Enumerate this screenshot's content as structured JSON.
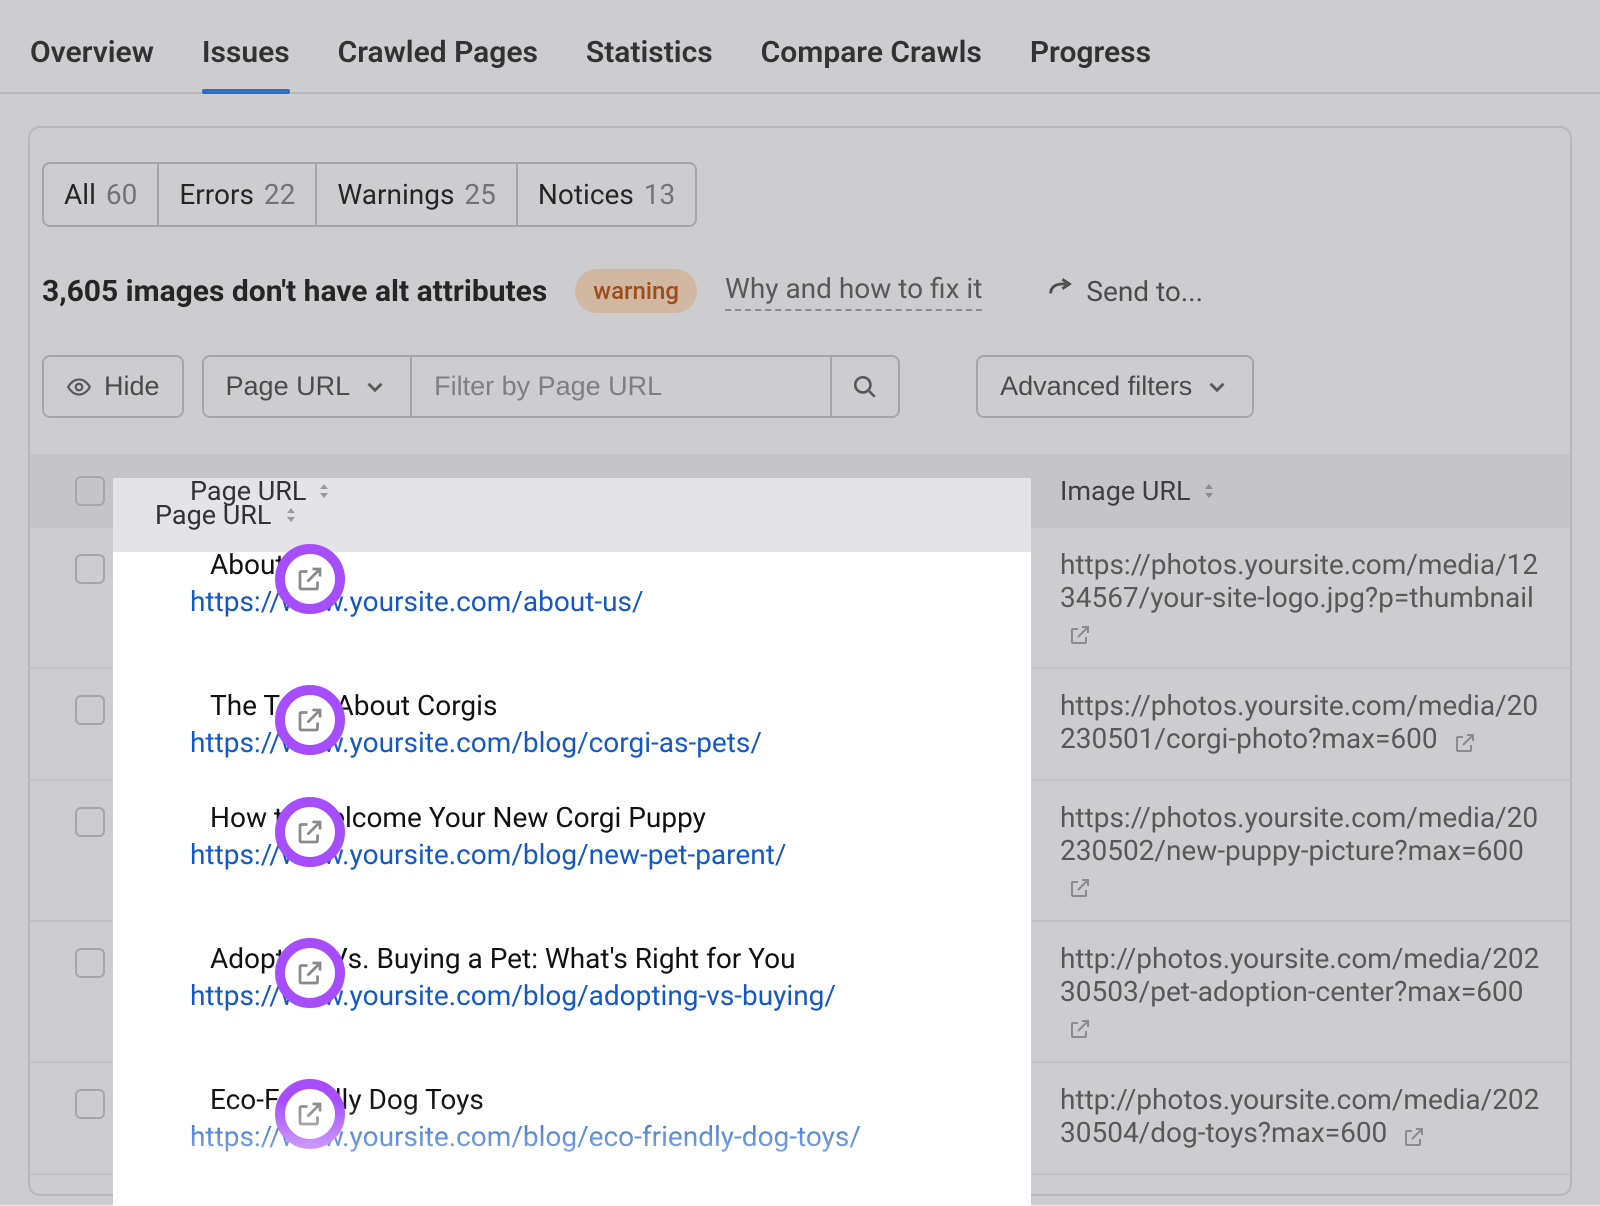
{
  "nav": {
    "tabs": [
      "Overview",
      "Issues",
      "Crawled Pages",
      "Statistics",
      "Compare Crawls",
      "Progress"
    ],
    "active_index": 1
  },
  "filters": {
    "chips": [
      {
        "label": "All",
        "count": "60"
      },
      {
        "label": "Errors",
        "count": "22"
      },
      {
        "label": "Warnings",
        "count": "25"
      },
      {
        "label": "Notices",
        "count": "13"
      }
    ]
  },
  "issue": {
    "headline": "3,605 images don't have alt attributes",
    "badge": "warning",
    "why_link": "Why and how to fix it",
    "send_to": "Send to..."
  },
  "toolbar": {
    "hide": "Hide",
    "column_select": "Page URL",
    "filter_placeholder": "Filter by Page URL",
    "advanced": "Advanced filters"
  },
  "table": {
    "columns": {
      "page": "Page URL",
      "image": "Image URL"
    },
    "rows": [
      {
        "title": "About Us",
        "url": "https://www.yoursite.com/about-us/",
        "image": "https://photos.yoursite.com/media/1234567/your-site-logo.jpg?p=thumbnail"
      },
      {
        "title": "The Truth About Corgis",
        "url": "https://www.yoursite.com/blog/corgi-as-pets/",
        "image": "https://photos.yoursite.com/media/20230501/corgi-photo?max=600"
      },
      {
        "title": "How to Welcome Your New Corgi Puppy",
        "url": "https://www.yoursite.com/blog/new-pet-parent/",
        "image": "https://photos.yoursite.com/media/20230502/new-puppy-picture?max=600"
      },
      {
        "title": "Adopting Vs. Buying a Pet: What's Right for You",
        "url": "https://www.yoursite.com/blog/adopting-vs-buying/",
        "image": "http://photos.yoursite.com/media/20230503/pet-adoption-center?max=600"
      },
      {
        "title": "Eco-Friendly Dog Toys",
        "url": "https://www.yoursite.com/blog/eco-friendly-dog-toys/",
        "image": "http://photos.yoursite.com/media/20230504/dog-toys?max=600"
      }
    ]
  },
  "colors": {
    "accent_purple": "#a64dff",
    "link_blue": "#1458c7",
    "tab_blue": "#1a73e8",
    "warn_bg": "#f7d6b8",
    "warn_fg": "#b34700"
  }
}
